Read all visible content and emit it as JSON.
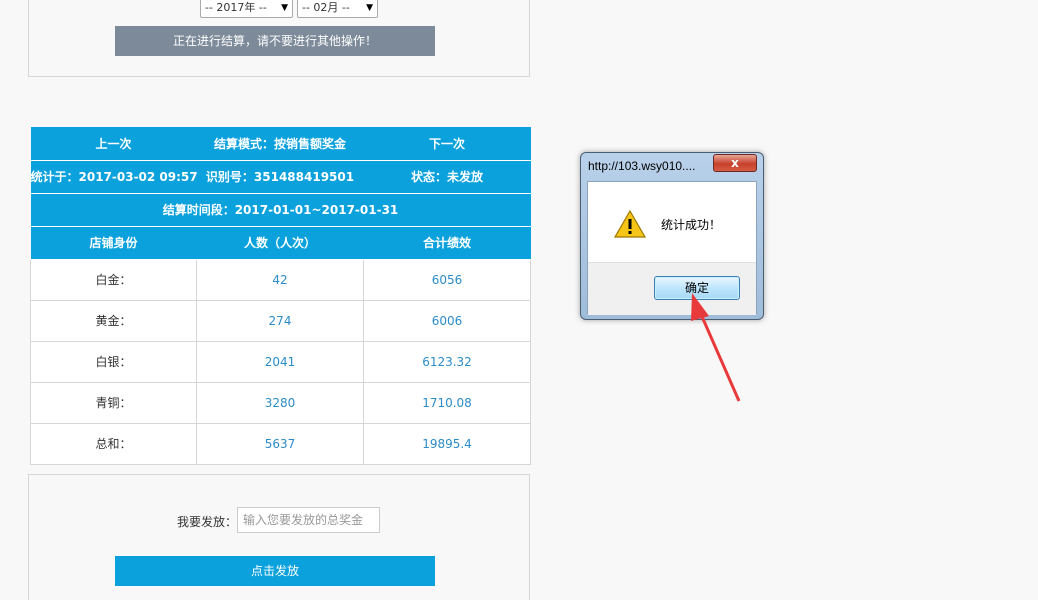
{
  "filters": {
    "year": "-- 2017年 --",
    "month": "-- 02月 --",
    "processing_notice": "正在进行结算，请不要进行其他操作！"
  },
  "summary": {
    "prev": "上一次",
    "mode": "结算模式：按销售额奖金",
    "next": "下一次",
    "stat_time": "统计于：2017-03-02 09:57:...",
    "id": "识别号：351488419501",
    "status": "状态：未发放",
    "period": "结算时间段：2017-01-01~2017-01-31",
    "headers": [
      "店铺身份",
      "人数（人次）",
      "合计绩效"
    ],
    "rows": [
      {
        "label": "白金：",
        "count": "42",
        "total": "6056"
      },
      {
        "label": "黄金：",
        "count": "274",
        "total": "6006"
      },
      {
        "label": "白银：",
        "count": "2041",
        "total": "6123.32"
      },
      {
        "label": "青铜：",
        "count": "3280",
        "total": "1710.08"
      },
      {
        "label": "总和：",
        "count": "5637",
        "total": "19895.4"
      }
    ]
  },
  "release": {
    "label": "我要发放：",
    "placeholder": "输入您要发放的总奖金",
    "button": "点击发放"
  },
  "dialog": {
    "title": "http://103.wsy010....",
    "close": "x",
    "message": "统计成功！",
    "ok": "确定"
  },
  "colors": {
    "accent": "#0aa1dc",
    "processing_button": "#7d8a99",
    "number_text": "#2c8cc8",
    "arrow": "#e83a3a"
  }
}
